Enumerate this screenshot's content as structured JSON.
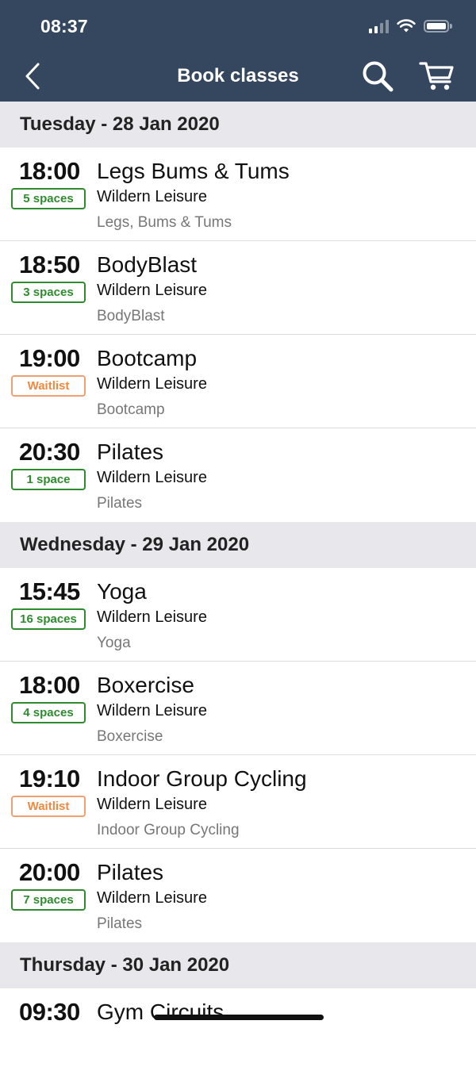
{
  "status_bar": {
    "time": "08:37"
  },
  "nav": {
    "title": "Book classes"
  },
  "days": [
    {
      "header": "Tuesday - 28 Jan 2020",
      "classes": [
        {
          "time": "18:00",
          "badge": "5 spaces",
          "badge_type": "spaces",
          "name": "Legs Bums & Tums",
          "venue": "Wildern Leisure",
          "sub": "Legs, Bums & Tums"
        },
        {
          "time": "18:50",
          "badge": "3 spaces",
          "badge_type": "spaces",
          "name": "BodyBlast",
          "venue": "Wildern Leisure",
          "sub": "BodyBlast"
        },
        {
          "time": "19:00",
          "badge": "Waitlist",
          "badge_type": "waitlist",
          "name": "Bootcamp",
          "venue": "Wildern Leisure",
          "sub": "Bootcamp"
        },
        {
          "time": "20:30",
          "badge": "1 space",
          "badge_type": "spaces",
          "name": "Pilates",
          "venue": "Wildern Leisure",
          "sub": "Pilates"
        }
      ]
    },
    {
      "header": "Wednesday - 29 Jan 2020",
      "classes": [
        {
          "time": "15:45",
          "badge": "16 spaces",
          "badge_type": "spaces",
          "name": "Yoga",
          "venue": "Wildern Leisure",
          "sub": "Yoga"
        },
        {
          "time": "18:00",
          "badge": "4 spaces",
          "badge_type": "spaces",
          "name": "Boxercise",
          "venue": "Wildern Leisure",
          "sub": "Boxercise"
        },
        {
          "time": "19:10",
          "badge": "Waitlist",
          "badge_type": "waitlist",
          "name": "Indoor Group Cycling",
          "venue": "Wildern Leisure",
          "sub": "Indoor Group Cycling"
        },
        {
          "time": "20:00",
          "badge": "7 spaces",
          "badge_type": "spaces",
          "name": "Pilates",
          "venue": "Wildern Leisure",
          "sub": "Pilates"
        }
      ]
    },
    {
      "header": "Thursday - 30 Jan 2020",
      "classes": [
        {
          "time": "09:30",
          "badge": "",
          "badge_type": "none",
          "name": "Gym Circuits",
          "venue": "",
          "sub": ""
        }
      ]
    }
  ],
  "colors": {
    "header_bg": "#34475f",
    "day_header_bg": "#e8e8ec",
    "spaces": "#2e8b2e",
    "waitlist": "#f0883e"
  }
}
